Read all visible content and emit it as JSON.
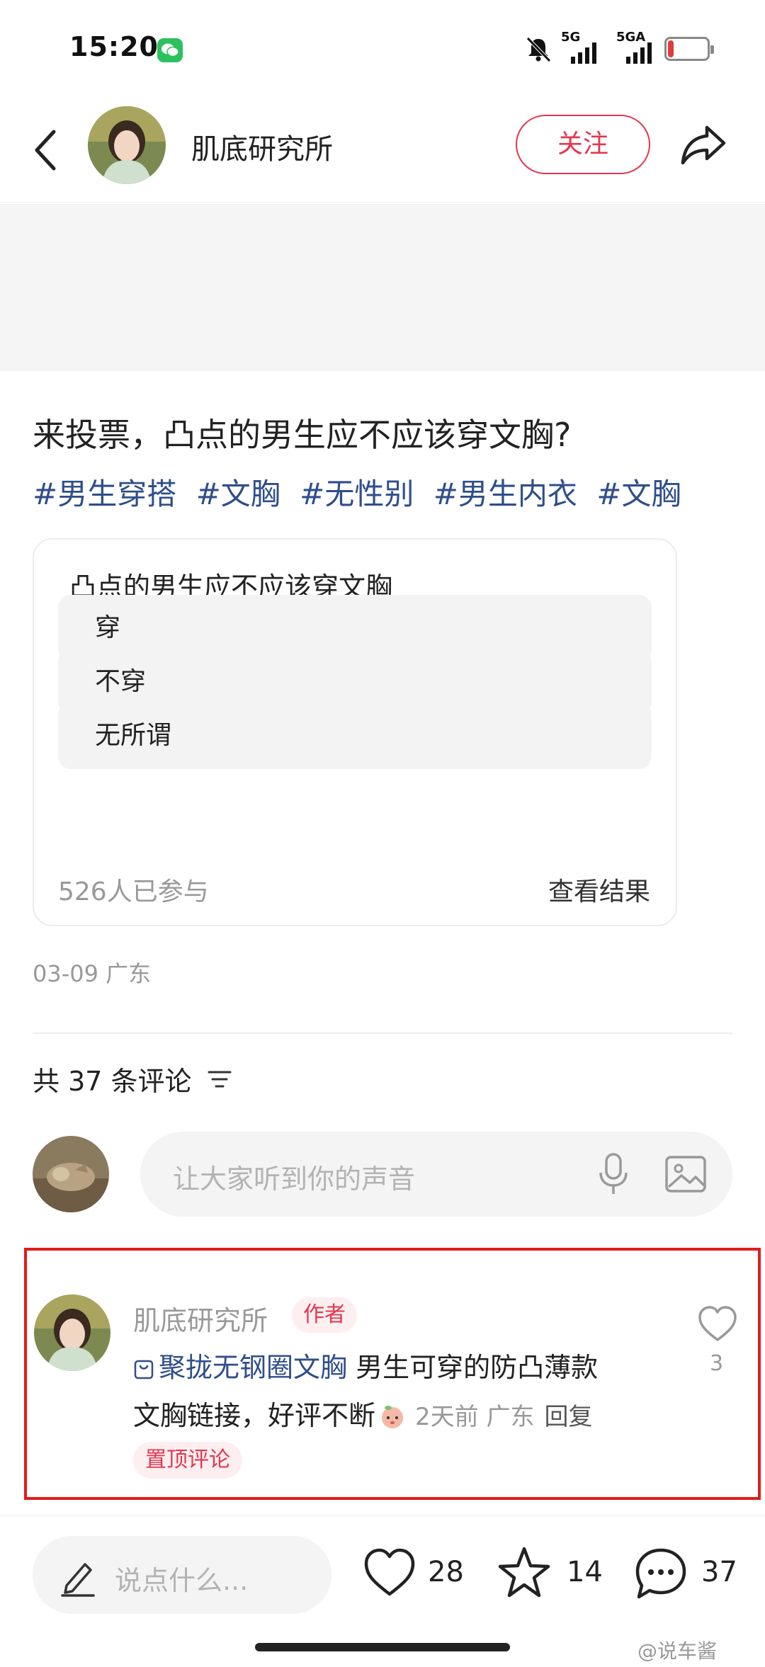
{
  "status_bar": {
    "time": "15:20",
    "battery": "15",
    "battery_level": 0.15,
    "signal_label_1": "5G",
    "signal_label_2": "5GA"
  },
  "header": {
    "author_name": "肌底研究所",
    "follow_label": "关注"
  },
  "post": {
    "title": "来投票，凸点的男生应不应该穿文胸?",
    "hashtags": [
      "#男生穿搭",
      "#文胸",
      "#无性别",
      "#男生内衣",
      "#文胸"
    ],
    "meta": "03-09 广东"
  },
  "poll": {
    "question": "凸点的男生应不应该穿文胸",
    "options": [
      "穿",
      "不穿",
      "无所谓"
    ],
    "participants": "526人已参与",
    "view_results": "查看结果"
  },
  "comments": {
    "header": "共 37 条评论",
    "input_placeholder": "让大家听到你的声音",
    "pinned": {
      "name": "肌底研究所",
      "author_badge": "作者",
      "product_link": "聚拢无钢圈文胸",
      "text_line1_rest": " 男生可穿的防凸薄款",
      "text_line2": "文胸链接，好评不断",
      "time_location": "2天前 广东",
      "reply": "回复",
      "pinned_badge": "置顶评论",
      "likes": "3"
    }
  },
  "bottom_bar": {
    "placeholder": "说点什么...",
    "likes": "28",
    "favorites": "14",
    "comments": "37"
  },
  "watermark": "@说车酱",
  "colors": {
    "accent_red": "#e2374f",
    "link_blue": "#2f4e8a",
    "highlight_border": "#e21b1b"
  }
}
